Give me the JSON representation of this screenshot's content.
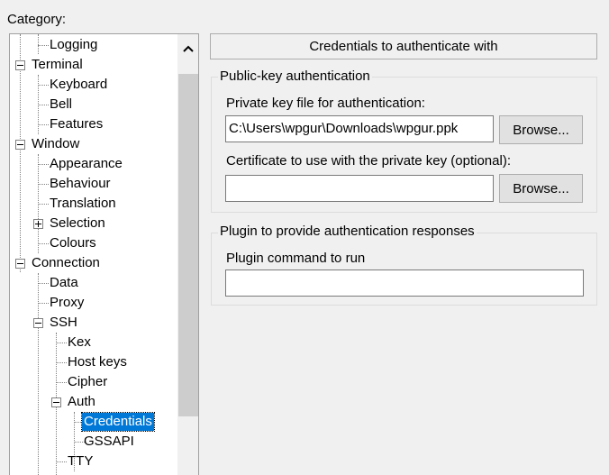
{
  "category_label": "Category:",
  "tree": {
    "items": [
      {
        "label": "Logging"
      },
      {
        "label": "Terminal"
      },
      {
        "label": "Keyboard"
      },
      {
        "label": "Bell"
      },
      {
        "label": "Features"
      },
      {
        "label": "Window"
      },
      {
        "label": "Appearance"
      },
      {
        "label": "Behaviour"
      },
      {
        "label": "Translation"
      },
      {
        "label": "Selection"
      },
      {
        "label": "Colours"
      },
      {
        "label": "Connection"
      },
      {
        "label": "Data"
      },
      {
        "label": "Proxy"
      },
      {
        "label": "SSH"
      },
      {
        "label": "Kex"
      },
      {
        "label": "Host keys"
      },
      {
        "label": "Cipher"
      },
      {
        "label": "Auth"
      },
      {
        "label": "Credentials"
      },
      {
        "label": "GSSAPI"
      },
      {
        "label": "TTY"
      }
    ],
    "selected": "Credentials"
  },
  "panel": {
    "header": "Credentials to authenticate with",
    "pubkey_group": {
      "title": "Public-key authentication",
      "private_key_label": "Private key file for authentication:",
      "private_key_value": "C:\\Users\\wpgur\\Downloads\\wpgur.ppk",
      "browse_label": "Browse...",
      "cert_label": "Certificate to use with the private key (optional):",
      "cert_value": "",
      "cert_browse_label": "Browse..."
    },
    "plugin_group": {
      "title": "Plugin to provide authentication responses",
      "command_label": "Plugin command to run",
      "command_value": ""
    }
  }
}
